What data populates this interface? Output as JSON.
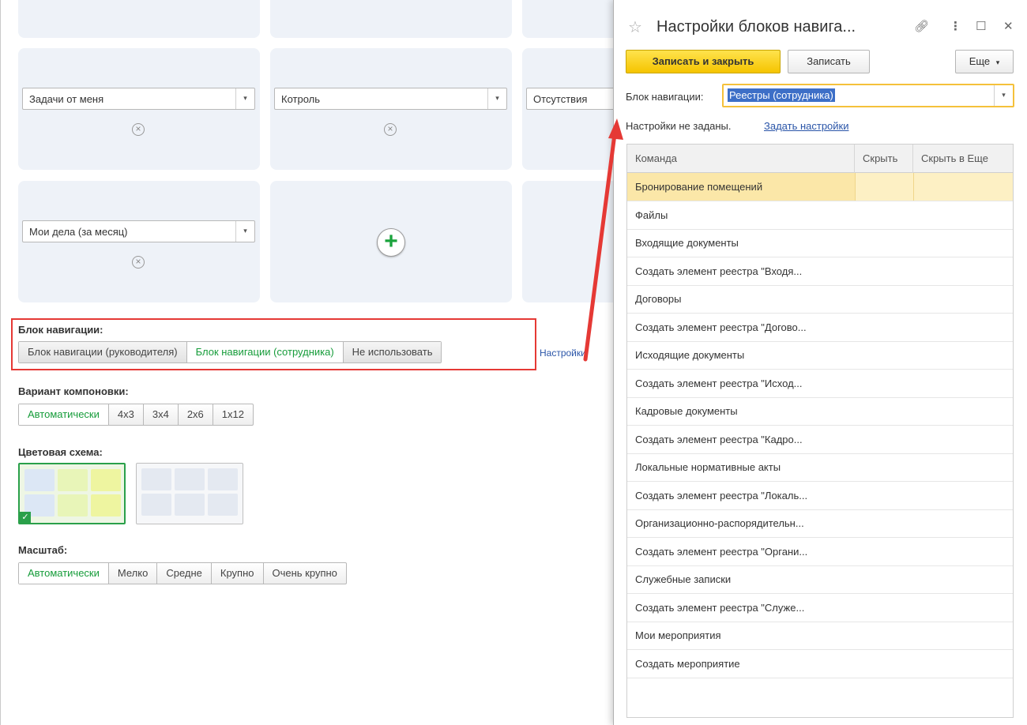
{
  "left": {
    "grid": {
      "row2": [
        {
          "combo": "Задачи от меня"
        },
        {
          "combo": "Котроль"
        },
        {
          "combo": "Отсутствия"
        }
      ],
      "row3": [
        {
          "combo": "Мои дела (за месяц)"
        }
      ]
    },
    "nav_block": {
      "label": "Блок навигации:",
      "options": [
        "Блок навигации (руководителя)",
        "Блок навигации (сотрудника)",
        "Не использовать"
      ],
      "selected": "Блок навигации (сотрудника)",
      "settings_link": "Настройки"
    },
    "layout_variant": {
      "label": "Вариант компоновки:",
      "options": [
        "Автоматически",
        "4x3",
        "3x4",
        "2x6",
        "1x12"
      ],
      "selected": "Автоматически"
    },
    "color_scheme": {
      "label": "Цветовая схема:"
    },
    "scale": {
      "label": "Масштаб:",
      "options": [
        "Автоматически",
        "Мелко",
        "Средне",
        "Крупно",
        "Очень крупно"
      ],
      "selected": "Автоматически"
    }
  },
  "panel": {
    "title": "Настройки блоков навига...",
    "buttons": {
      "save_close": "Записать и закрыть",
      "save": "Записать",
      "more": "Еще"
    },
    "nav_field": {
      "label": "Блок навигации:",
      "value": "Реестры (сотрудника)"
    },
    "status_text": "Настройки не заданы.",
    "set_link": "Задать настройки",
    "table": {
      "columns": [
        "Команда",
        "Скрыть",
        "Скрыть в Еще"
      ],
      "rows": [
        "Бронирование помещений",
        "Файлы",
        "Входящие документы",
        "Создать элемент реестра \"Входя...",
        "Договоры",
        "Создать элемент реестра \"Догово...",
        "Исходящие документы",
        "Создать элемент реестра \"Исход...",
        "Кадровые документы",
        "Создать элемент реестра \"Кадро...",
        "Локальные нормативные акты",
        "Создать элемент реестра \"Локаль...",
        "Организационно-распорядительн...",
        "Создать элемент реестра \"Органи...",
        "Служебные записки",
        "Создать элемент реестра \"Служе...",
        "Мои мероприятия",
        "Создать мероприятие"
      ]
    }
  },
  "colors": {
    "accent_green": "#169c3a",
    "highlight_red": "#e53935",
    "primary_yellow": "#f5c400",
    "selected_row": "#fbe7a8"
  }
}
